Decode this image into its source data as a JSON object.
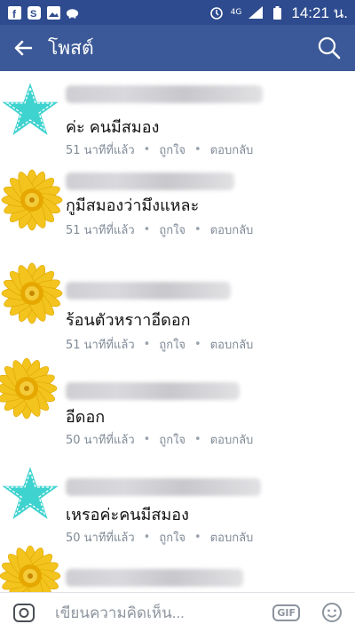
{
  "status_bar": {
    "time": "14:21 น.",
    "network": "4G"
  },
  "app_bar": {
    "title": "โพสต์",
    "back_icon": "arrow-left-icon",
    "search_icon": "search-icon"
  },
  "comments": [
    {
      "avatar": "star",
      "text": "ค่ะ  คนมีสมอง",
      "time": "51 นาทีที่แล้ว",
      "like": "ถูกใจ",
      "reply": "ตอบกลับ"
    },
    {
      "avatar": "flower",
      "text": "กูมีสมองว่ามึงแหละ",
      "time": "51 นาทีที่แล้ว",
      "like": "ถูกใจ",
      "reply": "ตอบกลับ"
    },
    {
      "avatar": "flower",
      "text": "ร้อนตัวหราาอีดอก",
      "time": "51 นาทีที่แล้ว",
      "like": "ถูกใจ",
      "reply": "ตอบกลับ"
    },
    {
      "avatar": "flower",
      "text": "อีดอก",
      "time": "50 นาทีที่แล้ว",
      "like": "ถูกใจ",
      "reply": "ตอบกลับ"
    },
    {
      "avatar": "star",
      "text": "เหรอค่ะคนมีสมอง",
      "time": "50 นาทีที่แล้ว",
      "like": "ถูกใจ",
      "reply": "ตอบกลับ"
    },
    {
      "avatar": "flower",
      "text": "",
      "time": "",
      "like": "",
      "reply": ""
    }
  ],
  "separator": "•",
  "composer": {
    "placeholder": "เขียนความคิดเห็น...",
    "gif_label": "GIF",
    "camera_icon": "camera-icon",
    "emoji_icon": "emoji-icon"
  },
  "colors": {
    "status_bar": "#2d4b8e",
    "app_bar": "#3b5998",
    "meta_text": "#7f8a96",
    "star": "#3fd3cf",
    "flower": "#f2c41d"
  }
}
